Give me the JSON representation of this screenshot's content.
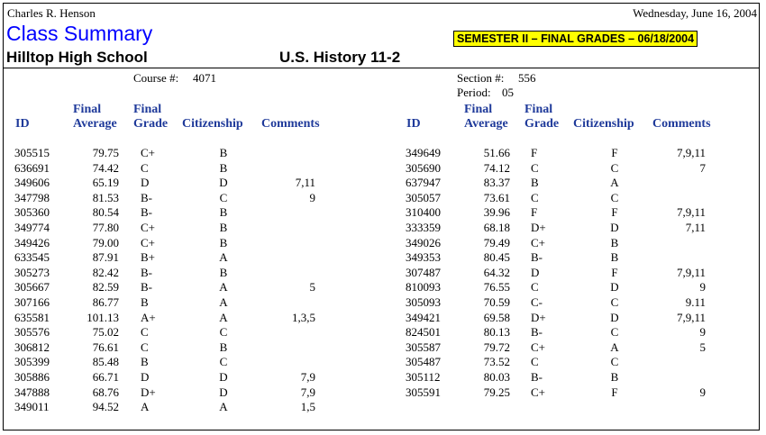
{
  "header": {
    "teacher": "Charles R. Henson",
    "date": "Wednesday, June 16, 2004",
    "report_title": "Class Summary",
    "semester_badge": "SEMESTER II – FINAL GRADES – 06/18/2004",
    "school": "Hilltop High School",
    "course_title": "U.S. History 11-2"
  },
  "meta": {
    "course_label": "Course #:",
    "course_number": "4071",
    "section_label": "Section #:",
    "section_number": "556",
    "period_label": "Period:",
    "period_number": "05"
  },
  "columns": {
    "id": "ID",
    "final_average_1": "Final",
    "final_average_2": "Average",
    "final_grade_1": "Final",
    "final_grade_2": "Grade",
    "citizenship": "Citizenship",
    "comments": "Comments"
  },
  "left_rows": [
    {
      "id": "305515",
      "avg": "79.75",
      "grade": "C+",
      "cit": "B",
      "comments": ""
    },
    {
      "id": "636691",
      "avg": "74.42",
      "grade": "C",
      "cit": "B",
      "comments": ""
    },
    {
      "id": "349606",
      "avg": "65.19",
      "grade": "D",
      "cit": "D",
      "comments": "7,11"
    },
    {
      "id": "347798",
      "avg": "81.53",
      "grade": "B-",
      "cit": "C",
      "comments": "9"
    },
    {
      "id": "305360",
      "avg": "80.54",
      "grade": "B-",
      "cit": "B",
      "comments": ""
    },
    {
      "id": "349774",
      "avg": "77.80",
      "grade": "C+",
      "cit": "B",
      "comments": ""
    },
    {
      "id": "349426",
      "avg": "79.00",
      "grade": "C+",
      "cit": "B",
      "comments": ""
    },
    {
      "id": "633545",
      "avg": "87.91",
      "grade": "B+",
      "cit": "A",
      "comments": ""
    },
    {
      "id": "305273",
      "avg": "82.42",
      "grade": "B-",
      "cit": "B",
      "comments": ""
    },
    {
      "id": "305667",
      "avg": "82.59",
      "grade": "B-",
      "cit": "A",
      "comments": "5"
    },
    {
      "id": "307166",
      "avg": "86.77",
      "grade": "B",
      "cit": "A",
      "comments": ""
    },
    {
      "id": "635581",
      "avg": "101.13",
      "grade": "A+",
      "cit": "A",
      "comments": "1,3,5"
    },
    {
      "id": "305576",
      "avg": "75.02",
      "grade": "C",
      "cit": "C",
      "comments": ""
    },
    {
      "id": "306812",
      "avg": "76.61",
      "grade": "C",
      "cit": "B",
      "comments": ""
    },
    {
      "id": "305399",
      "avg": "85.48",
      "grade": "B",
      "cit": "C",
      "comments": ""
    },
    {
      "id": "305886",
      "avg": "66.71",
      "grade": "D",
      "cit": "D",
      "comments": "7,9"
    },
    {
      "id": "347888",
      "avg": "68.76",
      "grade": "D+",
      "cit": "D",
      "comments": "7,9"
    },
    {
      "id": "349011",
      "avg": "94.52",
      "grade": "A",
      "cit": "A",
      "comments": "1,5"
    }
  ],
  "right_rows": [
    {
      "id": "349649",
      "avg": "51.66",
      "grade": "F",
      "cit": "F",
      "comments": "7,9,11"
    },
    {
      "id": "305690",
      "avg": "74.12",
      "grade": "C",
      "cit": "C",
      "comments": "7"
    },
    {
      "id": "637947",
      "avg": "83.37",
      "grade": "B",
      "cit": "A",
      "comments": ""
    },
    {
      "id": "305057",
      "avg": "73.61",
      "grade": "C",
      "cit": "C",
      "comments": ""
    },
    {
      "id": "310400",
      "avg": "39.96",
      "grade": "F",
      "cit": "F",
      "comments": "7,9,11"
    },
    {
      "id": "333359",
      "avg": "68.18",
      "grade": "D+",
      "cit": "D",
      "comments": "7,11"
    },
    {
      "id": "349026",
      "avg": "79.49",
      "grade": "C+",
      "cit": "B",
      "comments": ""
    },
    {
      "id": "349353",
      "avg": "80.45",
      "grade": "B-",
      "cit": "B",
      "comments": ""
    },
    {
      "id": "307487",
      "avg": "64.32",
      "grade": "D",
      "cit": "F",
      "comments": "7,9,11"
    },
    {
      "id": "810093",
      "avg": "76.55",
      "grade": "C",
      "cit": "D",
      "comments": "9"
    },
    {
      "id": "305093",
      "avg": "70.59",
      "grade": "C-",
      "cit": "C",
      "comments": "9.11"
    },
    {
      "id": "349421",
      "avg": "69.58",
      "grade": "D+",
      "cit": "D",
      "comments": "7,9,11"
    },
    {
      "id": "824501",
      "avg": "80.13",
      "grade": "B-",
      "cit": "C",
      "comments": "9"
    },
    {
      "id": "305587",
      "avg": "79.72",
      "grade": "C+",
      "cit": "A",
      "comments": "5"
    },
    {
      "id": "305487",
      "avg": "73.52",
      "grade": "C",
      "cit": "C",
      "comments": ""
    },
    {
      "id": "305112",
      "avg": "80.03",
      "grade": "B-",
      "cit": "B",
      "comments": ""
    },
    {
      "id": "305591",
      "avg": "79.25",
      "grade": "C+",
      "cit": "F",
      "comments": "9"
    }
  ]
}
